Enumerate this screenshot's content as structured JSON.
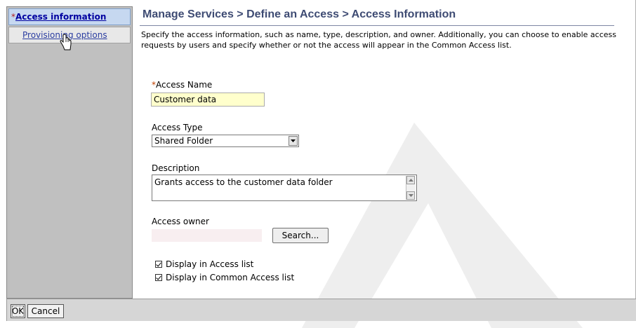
{
  "nav": {
    "required_marker": "*",
    "access_information": "Access information",
    "provisioning_options": "Provisioning options"
  },
  "header": {
    "title": "Manage Services > Define an Access > Access Information"
  },
  "intro_text": "Specify the access information, such as name, type, description, and owner. Additionally, you can choose to enable access requests by users and specify whether or not the access will appear in the Common Access list.",
  "form": {
    "required_marker": "*",
    "access_name_label": "Access Name",
    "access_name_value": "Customer data",
    "access_type_label": "Access Type",
    "access_type_value": "Shared Folder",
    "description_label": "Description",
    "description_value": "Grants access to the customer data folder",
    "access_owner_label": "Access owner",
    "access_owner_value": "",
    "search_button": "Search...",
    "display_access_list": "Display in Access list",
    "display_common_access_list": "Display in Common Access list"
  },
  "footer": {
    "ok_button": "OK",
    "cancel_button": "Cancel"
  },
  "colors": {
    "title": "#3e4b73",
    "nav_background": "#c0c0c0",
    "required_field": "#ffffcc"
  }
}
